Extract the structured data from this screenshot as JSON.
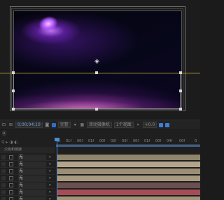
{
  "toolbar": {
    "time": "0;00;04;10",
    "quality": "完整",
    "active_camera": "活动摄像机",
    "views": "1个视图",
    "zoom": "+0.0"
  },
  "timeline": {
    "tab_label": "Ⓐ",
    "layer_column_header": "父级和链接",
    "layers": [
      {
        "mode": "无",
        "bar_color": "#8f846e"
      },
      {
        "mode": "无",
        "bar_color": "#b3a58b"
      },
      {
        "mode": "无",
        "bar_color": "#9b8e75"
      },
      {
        "mode": "无",
        "bar_color": "#a89a80"
      },
      {
        "mode": "无",
        "bar_color": "#6a5050"
      },
      {
        "mode": "无",
        "bar_color": "#a44d56"
      },
      {
        "mode": "无",
        "bar_color": "#a19479"
      }
    ],
    "ruler_ticks": [
      "0:",
      "01f",
      "00f",
      "01f",
      "00f",
      "02f",
      "03f",
      "00f",
      "01f",
      "00f",
      "04f",
      "00f",
      "0"
    ]
  },
  "colors": {
    "playhead": "#4e8ad8",
    "guide_line": "#b49a2a"
  }
}
